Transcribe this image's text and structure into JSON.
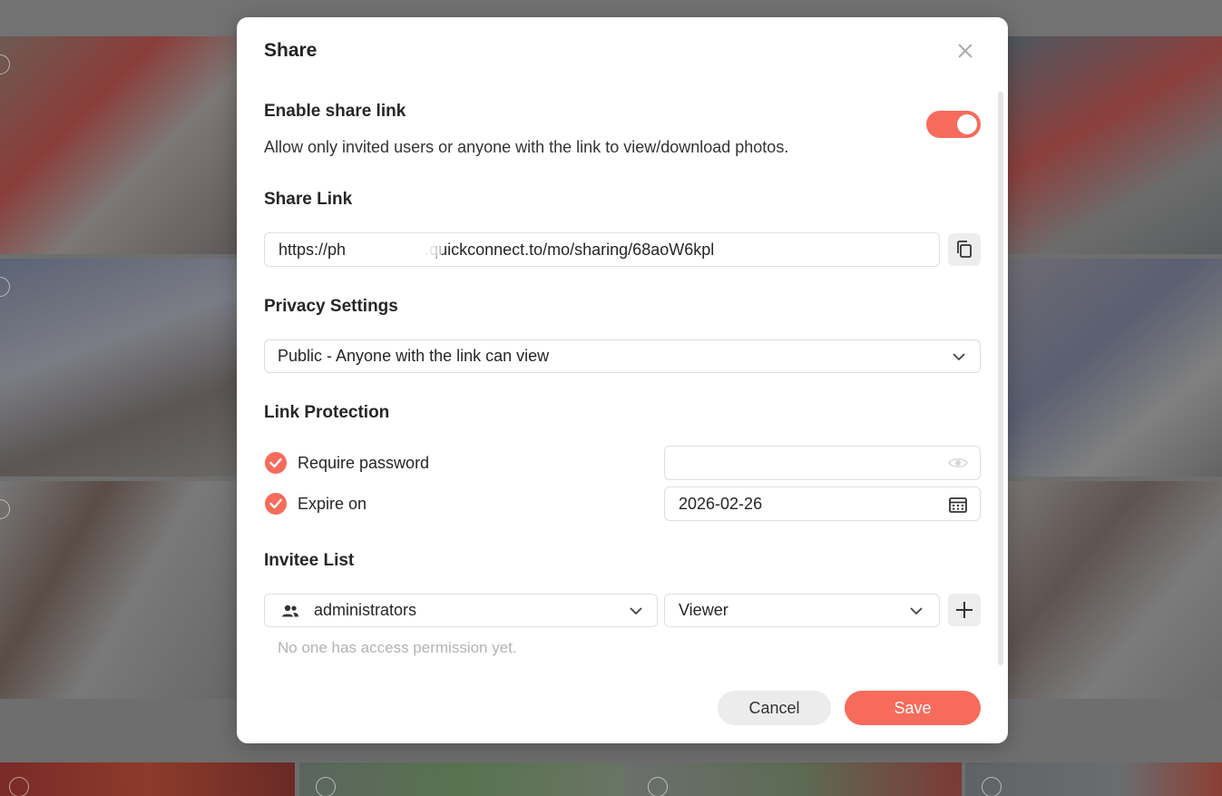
{
  "dialog": {
    "title": "Share"
  },
  "enable_share": {
    "title": "Enable share link",
    "description": "Allow only invited users or anyone with the link to view/download photos.",
    "enabled": true
  },
  "share_link": {
    "title": "Share Link",
    "url_prefix": "https://ph",
    "url_suffix": ".quickconnect.to/mo/sharing/68aoW6kpl"
  },
  "privacy": {
    "title": "Privacy Settings",
    "selected": "Public - Anyone with the link can view"
  },
  "link_protection": {
    "title": "Link Protection",
    "require_password_label": "Require password",
    "require_password_checked": true,
    "password_value": "",
    "expire_label": "Expire on",
    "expire_checked": true,
    "expire_date": "2026-02-26"
  },
  "invitee": {
    "title": "Invitee List",
    "group": "administrators",
    "role": "Viewer",
    "empty_note": "No one has access permission yet."
  },
  "actions": {
    "cancel_label": "Cancel",
    "save_label": "Save"
  },
  "colors": {
    "accent": "#f76b5c",
    "overlay": "#6e6e6e"
  },
  "icons": {
    "close": "close-icon",
    "copy": "copy-icon",
    "eye": "eye-icon",
    "calendar": "calendar-icon",
    "group": "users-icon",
    "add": "plus-icon",
    "chevron": "chevron-down-icon",
    "check": "check-icon"
  }
}
